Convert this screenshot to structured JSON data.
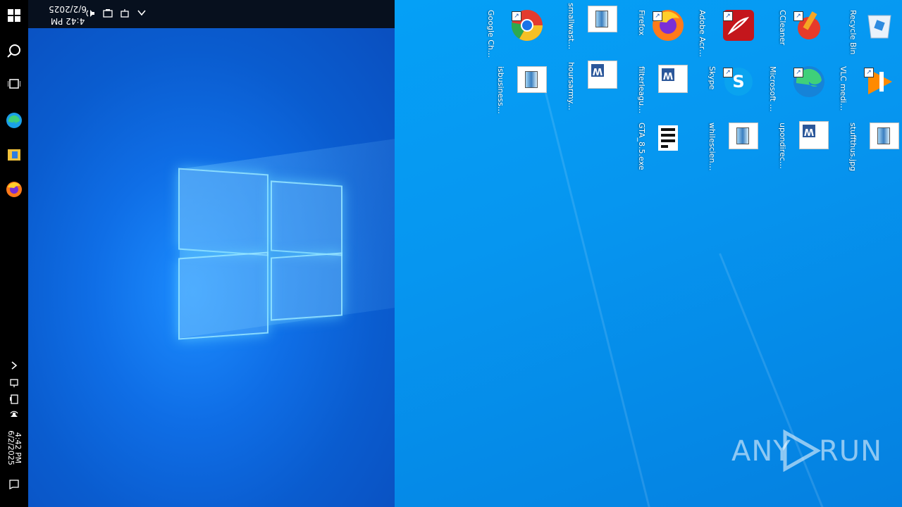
{
  "topbar": {
    "time": "4:42 PM",
    "date": "6/2/2025"
  },
  "sidebar": {
    "time": "4:42 PM",
    "date": "6/2/2025",
    "icons": [
      "windows-start-icon",
      "search-icon",
      "task-view-icon",
      "edge-icon",
      "file-explorer-icon",
      "firefox-icon",
      "chevron-icon",
      "network-icon",
      "battery-icon",
      "volume-icon",
      "notification-icon"
    ]
  },
  "desktop": {
    "icons": [
      {
        "label": "Recycle Bin",
        "type": "recycle-bin-icon"
      },
      {
        "label": "VLC media player",
        "type": "vlc-icon"
      },
      {
        "label": "stuffthus.jpg",
        "type": "image-file-icon"
      },
      {
        "label": "CCleaner",
        "type": "ccleaner-icon"
      },
      {
        "label": "Microsoft Edge",
        "type": "edge-icon"
      },
      {
        "label": "upondirecti...",
        "type": "word-doc-icon"
      },
      {
        "label": "Adobe Acrobat",
        "type": "acrobat-icon"
      },
      {
        "label": "Skype",
        "type": "skype-icon"
      },
      {
        "label": "whilescienc...",
        "type": "image-file-icon"
      },
      {
        "label": "Firefox",
        "type": "firefox-icon"
      },
      {
        "label": "filterleague.rtf",
        "type": "word-doc-icon"
      },
      {
        "label": "GTA_8.5.exe",
        "type": "exe-icon"
      },
      {
        "label": "smallwaste....",
        "type": "image-file-icon"
      },
      {
        "label": "hoursarmy.rtf",
        "type": "word-doc-icon"
      },
      {
        "label": "Google Chrome",
        "type": "chrome-icon"
      },
      {
        "label": "isbusiness.jpg",
        "type": "image-file-icon"
      }
    ]
  },
  "watermark": {
    "left": "ANY",
    "right": "RUN"
  }
}
